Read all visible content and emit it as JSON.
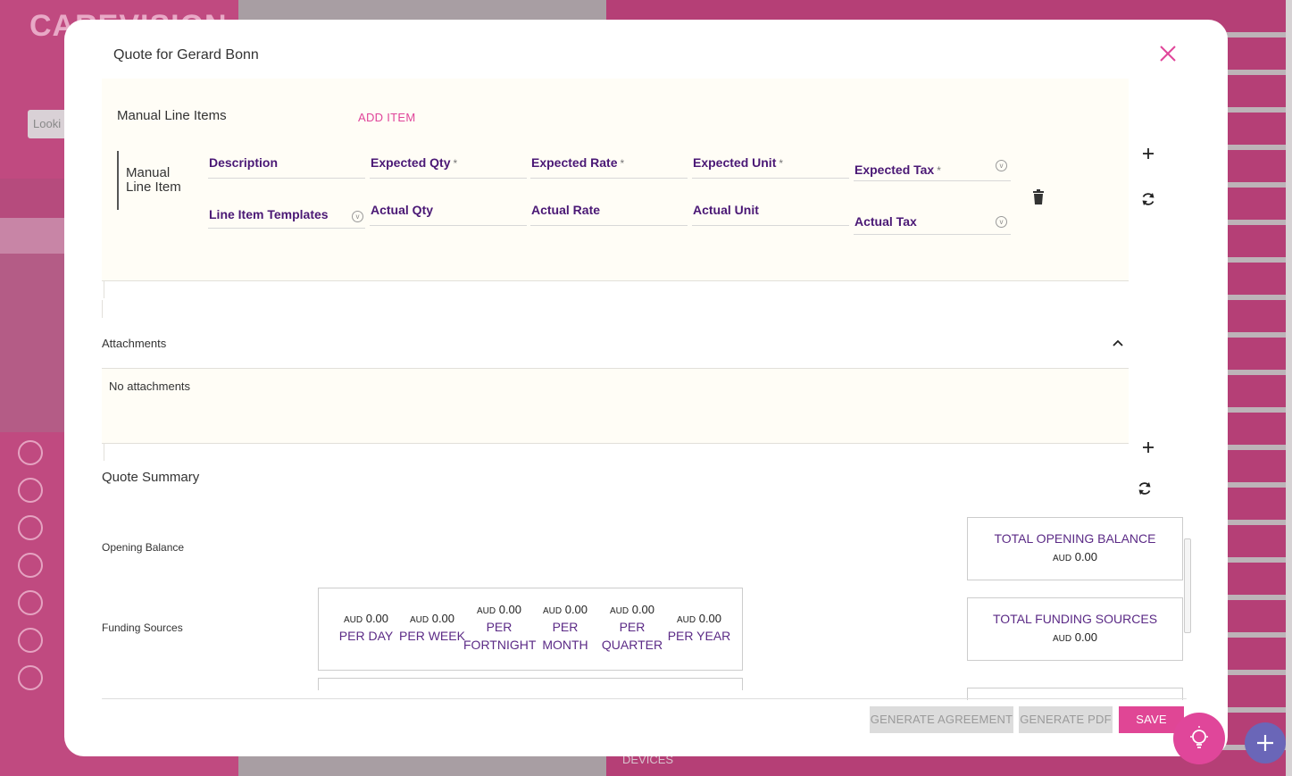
{
  "background": {
    "logo": "CAREVISION",
    "search_placeholder": "Looki",
    "devices_label": "DEVICES"
  },
  "modal": {
    "title": "Quote for Gerard Bonn",
    "manual_line_items": {
      "title": "Manual Line Items",
      "add_item_label": "ADD ITEM",
      "row_label": "Manual Line Item",
      "fields": {
        "description": "Description",
        "expected_qty": "Expected Qty",
        "expected_rate": "Expected Rate",
        "expected_unit": "Expected Unit",
        "expected_tax": "Expected Tax",
        "line_item_templates": "Line Item Templates",
        "actual_qty": "Actual Qty",
        "actual_rate": "Actual Rate",
        "actual_unit": "Actual Unit",
        "actual_tax": "Actual Tax"
      },
      "required_mark": "*"
    },
    "attachments": {
      "title": "Attachments",
      "empty_text": "No attachments"
    },
    "quote_summary": {
      "title": "Quote Summary",
      "opening_balance_label": "Opening Balance",
      "funding_sources_label": "Funding Sources",
      "currency": "AUD",
      "frequencies": [
        {
          "amount": "0.00",
          "label_1": "PER DAY",
          "label_2": ""
        },
        {
          "amount": "0.00",
          "label_1": "PER WEEK",
          "label_2": ""
        },
        {
          "amount": "0.00",
          "label_1": "PER",
          "label_2": "FORTNIGHT"
        },
        {
          "amount": "0.00",
          "label_1": "PER",
          "label_2": "MONTH"
        },
        {
          "amount": "0.00",
          "label_1": "PER",
          "label_2": "QUARTER"
        },
        {
          "amount": "0.00",
          "label_1": "PER YEAR",
          "label_2": ""
        }
      ],
      "total_opening_balance": {
        "title": "TOTAL OPENING BALANCE",
        "amount": "0.00"
      },
      "total_funding_sources": {
        "title": "TOTAL FUNDING SOURCES",
        "amount": "0.00"
      }
    },
    "footer": {
      "generate_agreement": "GENERATE AGREEMENT",
      "generate_pdf": "GENERATE PDF",
      "save": "SAVE"
    }
  },
  "colors": {
    "brand_pink": "#e0469a",
    "label_purple": "#4a1875",
    "panel_bg": "#fffdf6"
  }
}
